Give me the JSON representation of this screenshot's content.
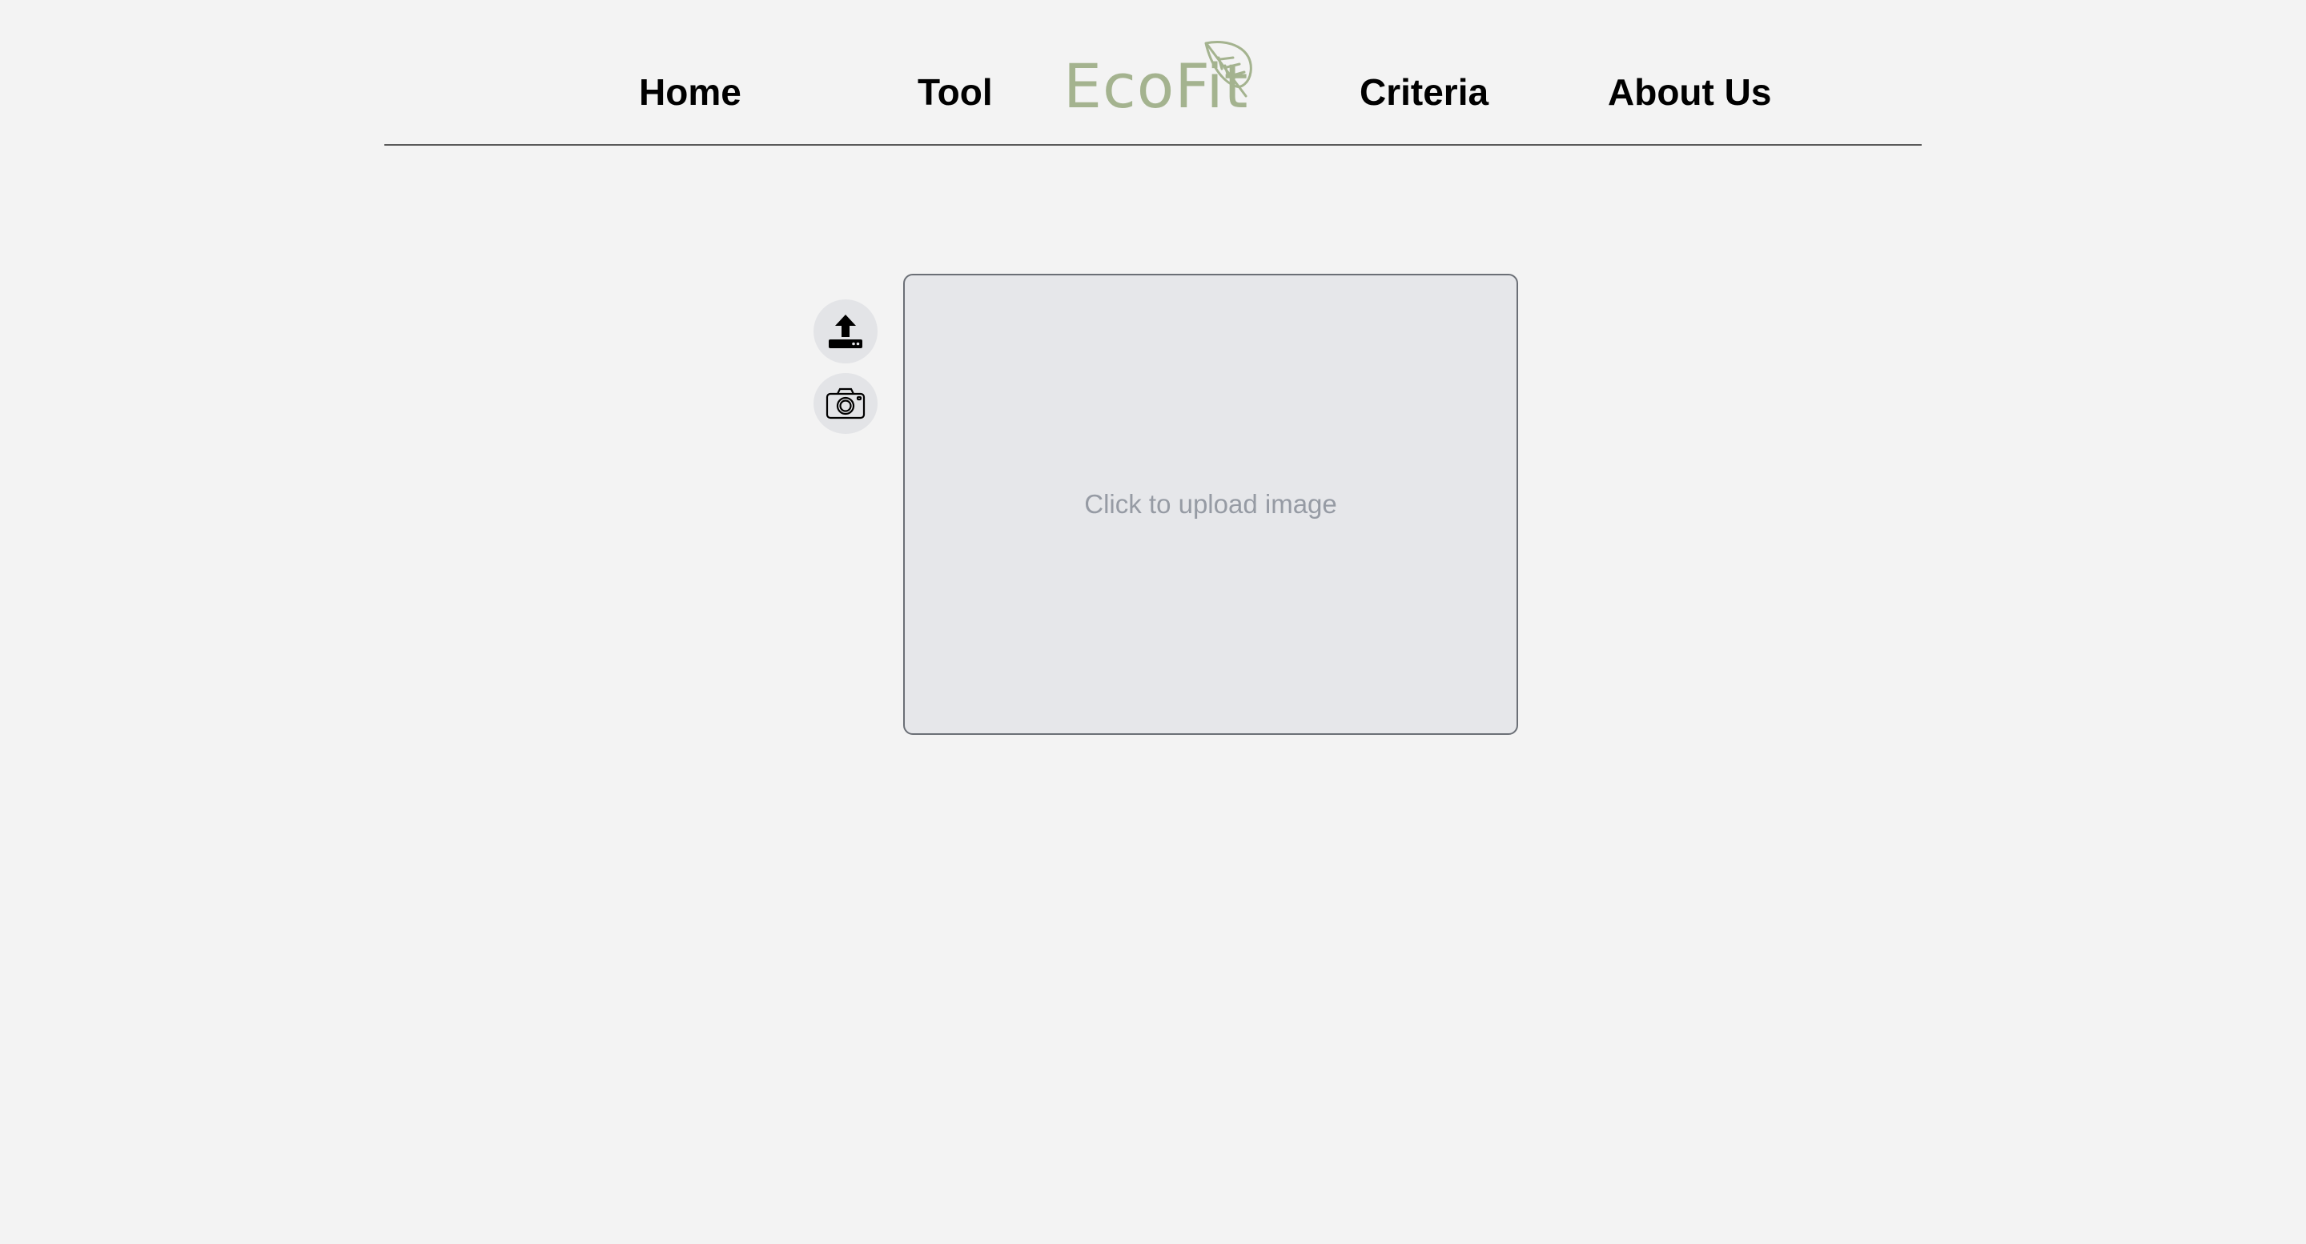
{
  "nav": {
    "home_label": "Home",
    "tool_label": "Tool",
    "criteria_label": "Criteria",
    "about_label": "About Us"
  },
  "logo": {
    "text": "EcoFit",
    "icon": "leaf-icon",
    "color": "#a4b38f"
  },
  "actions": {
    "upload_icon": "upload-icon",
    "camera_icon": "camera-icon"
  },
  "upload": {
    "prompt": "Click to upload image"
  },
  "colors": {
    "background": "#f3f3f3",
    "upload_area": "#e6e7ea",
    "upload_border": "#6b6f76",
    "prompt_text": "#969ba4",
    "button_bg": "#e3e4e7"
  }
}
